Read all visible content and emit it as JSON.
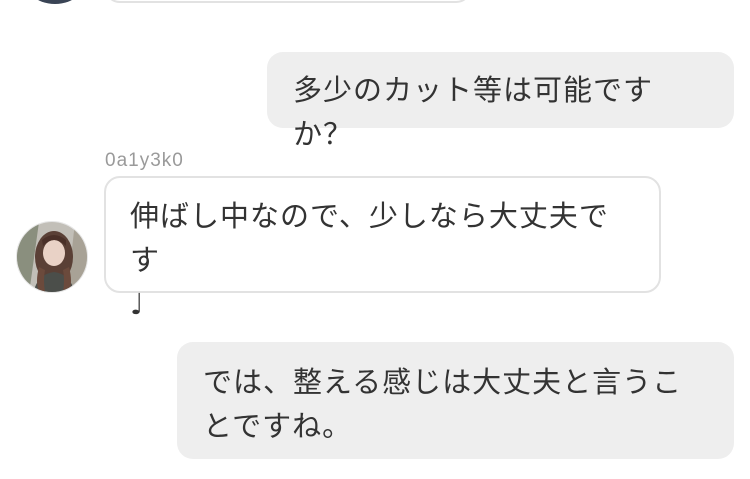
{
  "conversation": {
    "messages": [
      {
        "direction": "incoming",
        "text": ""
      },
      {
        "direction": "outgoing",
        "text": "多少のカット等は可能ですか？"
      },
      {
        "direction": "incoming",
        "sender": "0a1y3k0",
        "text": "伸ばし中なので、少しなら大丈夫です\n♩"
      },
      {
        "direction": "outgoing",
        "text": "では、整える感じは大丈夫と言うことですね。"
      }
    ]
  },
  "colors": {
    "incoming_bubble_bg": "#ffffff",
    "incoming_bubble_border": "#e2e2e2",
    "outgoing_bubble_bg": "#eeeeee",
    "text": "#333333",
    "sender_name": "#9a9a9a"
  }
}
